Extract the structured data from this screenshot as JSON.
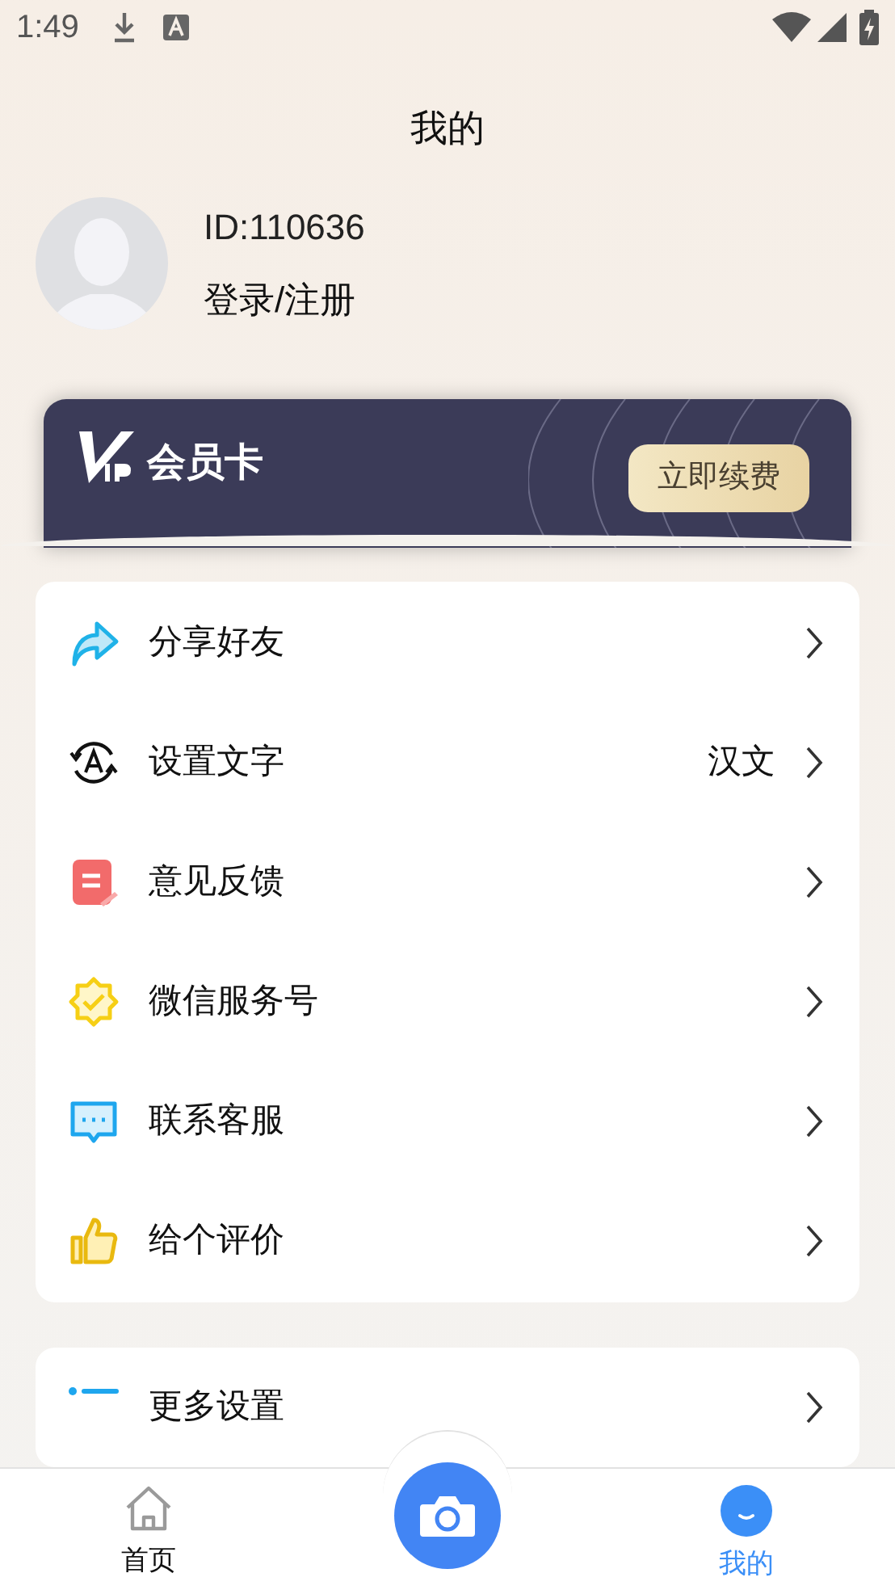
{
  "status_bar": {
    "time": "1:49"
  },
  "title": "我的",
  "profile": {
    "id": "ID:110636",
    "login": "登录/注册"
  },
  "vip_card": {
    "title": "会员卡",
    "button": "立即续费"
  },
  "menu": [
    {
      "kind": "share",
      "label": "分享好友"
    },
    {
      "kind": "language",
      "label": "设置文字",
      "value": "汉文"
    },
    {
      "kind": "feedback",
      "label": "意见反馈"
    },
    {
      "kind": "badge",
      "label": "微信服务号"
    },
    {
      "kind": "chat",
      "label": "联系客服"
    },
    {
      "kind": "thumb",
      "label": "给个评价"
    }
  ],
  "menu_2": [
    {
      "kind": "list",
      "label": "更多设置"
    }
  ],
  "tab_bar": [
    {
      "kind": "home",
      "label": "首页",
      "selected": false
    },
    {
      "kind": "camera"
    },
    {
      "kind": "me",
      "label": "我的",
      "selected": true
    }
  ]
}
